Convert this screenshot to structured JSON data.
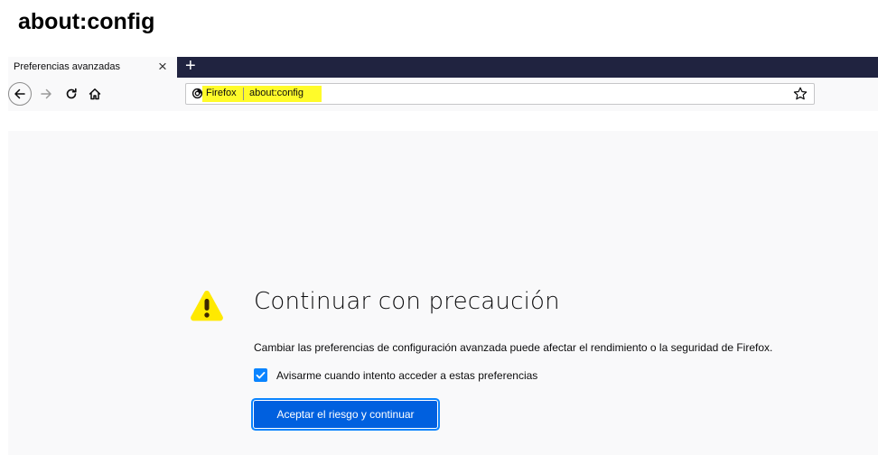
{
  "page_heading": "about:config",
  "tab": {
    "title": "Preferencias avanzadas",
    "close_glyph": "×",
    "new_tab_glyph": "+"
  },
  "navbar": {
    "back_icon": "back-arrow-icon",
    "forward_icon": "forward-arrow-icon",
    "reload_icon": "reload-icon",
    "home_icon": "home-icon",
    "identity_label": "Firefox",
    "url": "about:config",
    "bookmark_icon": "star-icon",
    "highlight_color": "#fffb2a"
  },
  "content": {
    "title": "Continuar con precaución",
    "description": "Cambiar las preferencias de configuración avanzada puede afectar el rendimiento o la seguridad de Firefox.",
    "checkbox_label": "Avisarme cuando intento acceder a estas preferencias",
    "checkbox_checked": true,
    "accept_button": "Aceptar el riesgo y continuar",
    "warning_icon": "warning-icon",
    "warning_color": "#ffe900",
    "button_color": "#0060df"
  }
}
